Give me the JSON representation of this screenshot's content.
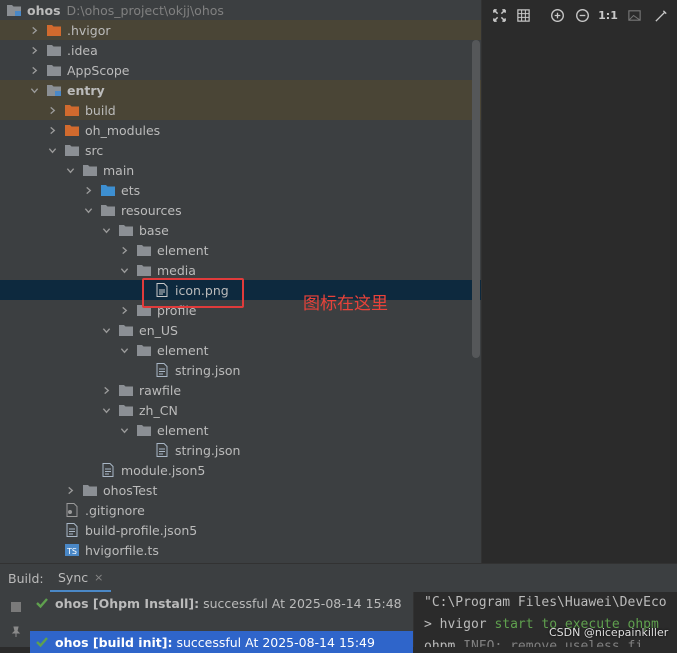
{
  "tree": {
    "root": {
      "label": "ohos",
      "path": "D:\\ohos_project\\okjj\\ohos"
    },
    "items": [
      {
        "label": "ohos",
        "path": "D:\\ohos_project\\okjj\\ohos",
        "icon": "module-folder-icon",
        "chevron": "down",
        "level": 0,
        "root": true
      },
      {
        "label": ".hvigor",
        "icon": "excluded-folder-icon",
        "chevron": "right",
        "level": 1,
        "excluded": true
      },
      {
        "label": ".idea",
        "icon": "folder-icon",
        "chevron": "right",
        "level": 1
      },
      {
        "label": "AppScope",
        "icon": "folder-icon",
        "chevron": "right",
        "level": 1
      },
      {
        "label": "entry",
        "icon": "module-folder-icon",
        "chevron": "down",
        "level": 1,
        "bold": true,
        "excluded": true
      },
      {
        "label": "build",
        "icon": "excluded-folder-icon",
        "chevron": "right",
        "level": 2,
        "excluded": true
      },
      {
        "label": "oh_modules",
        "icon": "excluded-folder-icon",
        "chevron": "right",
        "level": 2
      },
      {
        "label": "src",
        "icon": "folder-icon",
        "chevron": "down",
        "level": 2
      },
      {
        "label": "main",
        "icon": "folder-icon",
        "chevron": "down",
        "level": 3
      },
      {
        "label": "ets",
        "icon": "source-folder-icon",
        "chevron": "right",
        "level": 4
      },
      {
        "label": "resources",
        "icon": "folder-icon",
        "chevron": "down",
        "level": 4
      },
      {
        "label": "base",
        "icon": "folder-icon",
        "chevron": "down",
        "level": 5
      },
      {
        "label": "element",
        "icon": "folder-icon",
        "chevron": "right",
        "level": 6
      },
      {
        "label": "media",
        "icon": "folder-icon",
        "chevron": "down",
        "level": 6
      },
      {
        "label": "icon.png",
        "icon": "image-file-icon",
        "chevron": "none",
        "level": 7,
        "selected": true
      },
      {
        "label": "profile",
        "icon": "folder-icon",
        "chevron": "right",
        "level": 6
      },
      {
        "label": "en_US",
        "icon": "folder-icon",
        "chevron": "down",
        "level": 5
      },
      {
        "label": "element",
        "icon": "folder-icon",
        "chevron": "down",
        "level": 6
      },
      {
        "label": "string.json",
        "icon": "json-file-icon",
        "chevron": "none",
        "level": 7
      },
      {
        "label": "rawfile",
        "icon": "folder-icon",
        "chevron": "right",
        "level": 5
      },
      {
        "label": "zh_CN",
        "icon": "folder-icon",
        "chevron": "down",
        "level": 5
      },
      {
        "label": "element",
        "icon": "folder-icon",
        "chevron": "down",
        "level": 6
      },
      {
        "label": "string.json",
        "icon": "json-file-icon",
        "chevron": "none",
        "level": 7
      },
      {
        "label": "module.json5",
        "icon": "json-file-icon",
        "chevron": "none",
        "level": 4
      },
      {
        "label": "ohosTest",
        "icon": "folder-icon",
        "chevron": "right",
        "level": 3
      },
      {
        "label": ".gitignore",
        "icon": "text-file-icon",
        "chevron": "none",
        "level": 2
      },
      {
        "label": "build-profile.json5",
        "icon": "json-file-icon",
        "chevron": "none",
        "level": 2
      },
      {
        "label": "hvigorfile.ts",
        "icon": "ts-file-icon",
        "chevron": "none",
        "level": 2
      }
    ]
  },
  "annotation": {
    "text": "图标在这里"
  },
  "preview_toolbar": {
    "items": [
      "fit-screen-icon",
      "grid-icon",
      "zoom-in-icon",
      "zoom-out-icon",
      "actual-size",
      "background-icon",
      "color-picker-icon"
    ],
    "actual_size_label": "1:1"
  },
  "build_panel": {
    "label": "Build:",
    "tab_label": "Sync",
    "tab_close": "×",
    "entries": [
      {
        "name": "ohos [Ohpm Install]:",
        "result": "successful At 2025-08-14 15:48",
        "selected": false
      },
      {
        "name": "ohos [build init]:",
        "result": "successful At 2025-08-14 15:49",
        "selected": true
      }
    ],
    "console": {
      "line1": "\"C:\\Program Files\\Huawei\\DevEco",
      "line2_prefix": "> hvigor ",
      "line2_highlight": "start to execute ohpm",
      "line3_prefix": "ohpm ",
      "line3_rest": "INFO: remove useless fi"
    }
  },
  "watermark": "CSDN @nicepainkiller",
  "colors": {
    "folder": "#8b8f94",
    "excluded_folder": "#d16a2e",
    "source_folder": "#3d8fd1",
    "selection": "#0d293e",
    "annotation": "#e03b3b",
    "success": "#5fa04e"
  }
}
